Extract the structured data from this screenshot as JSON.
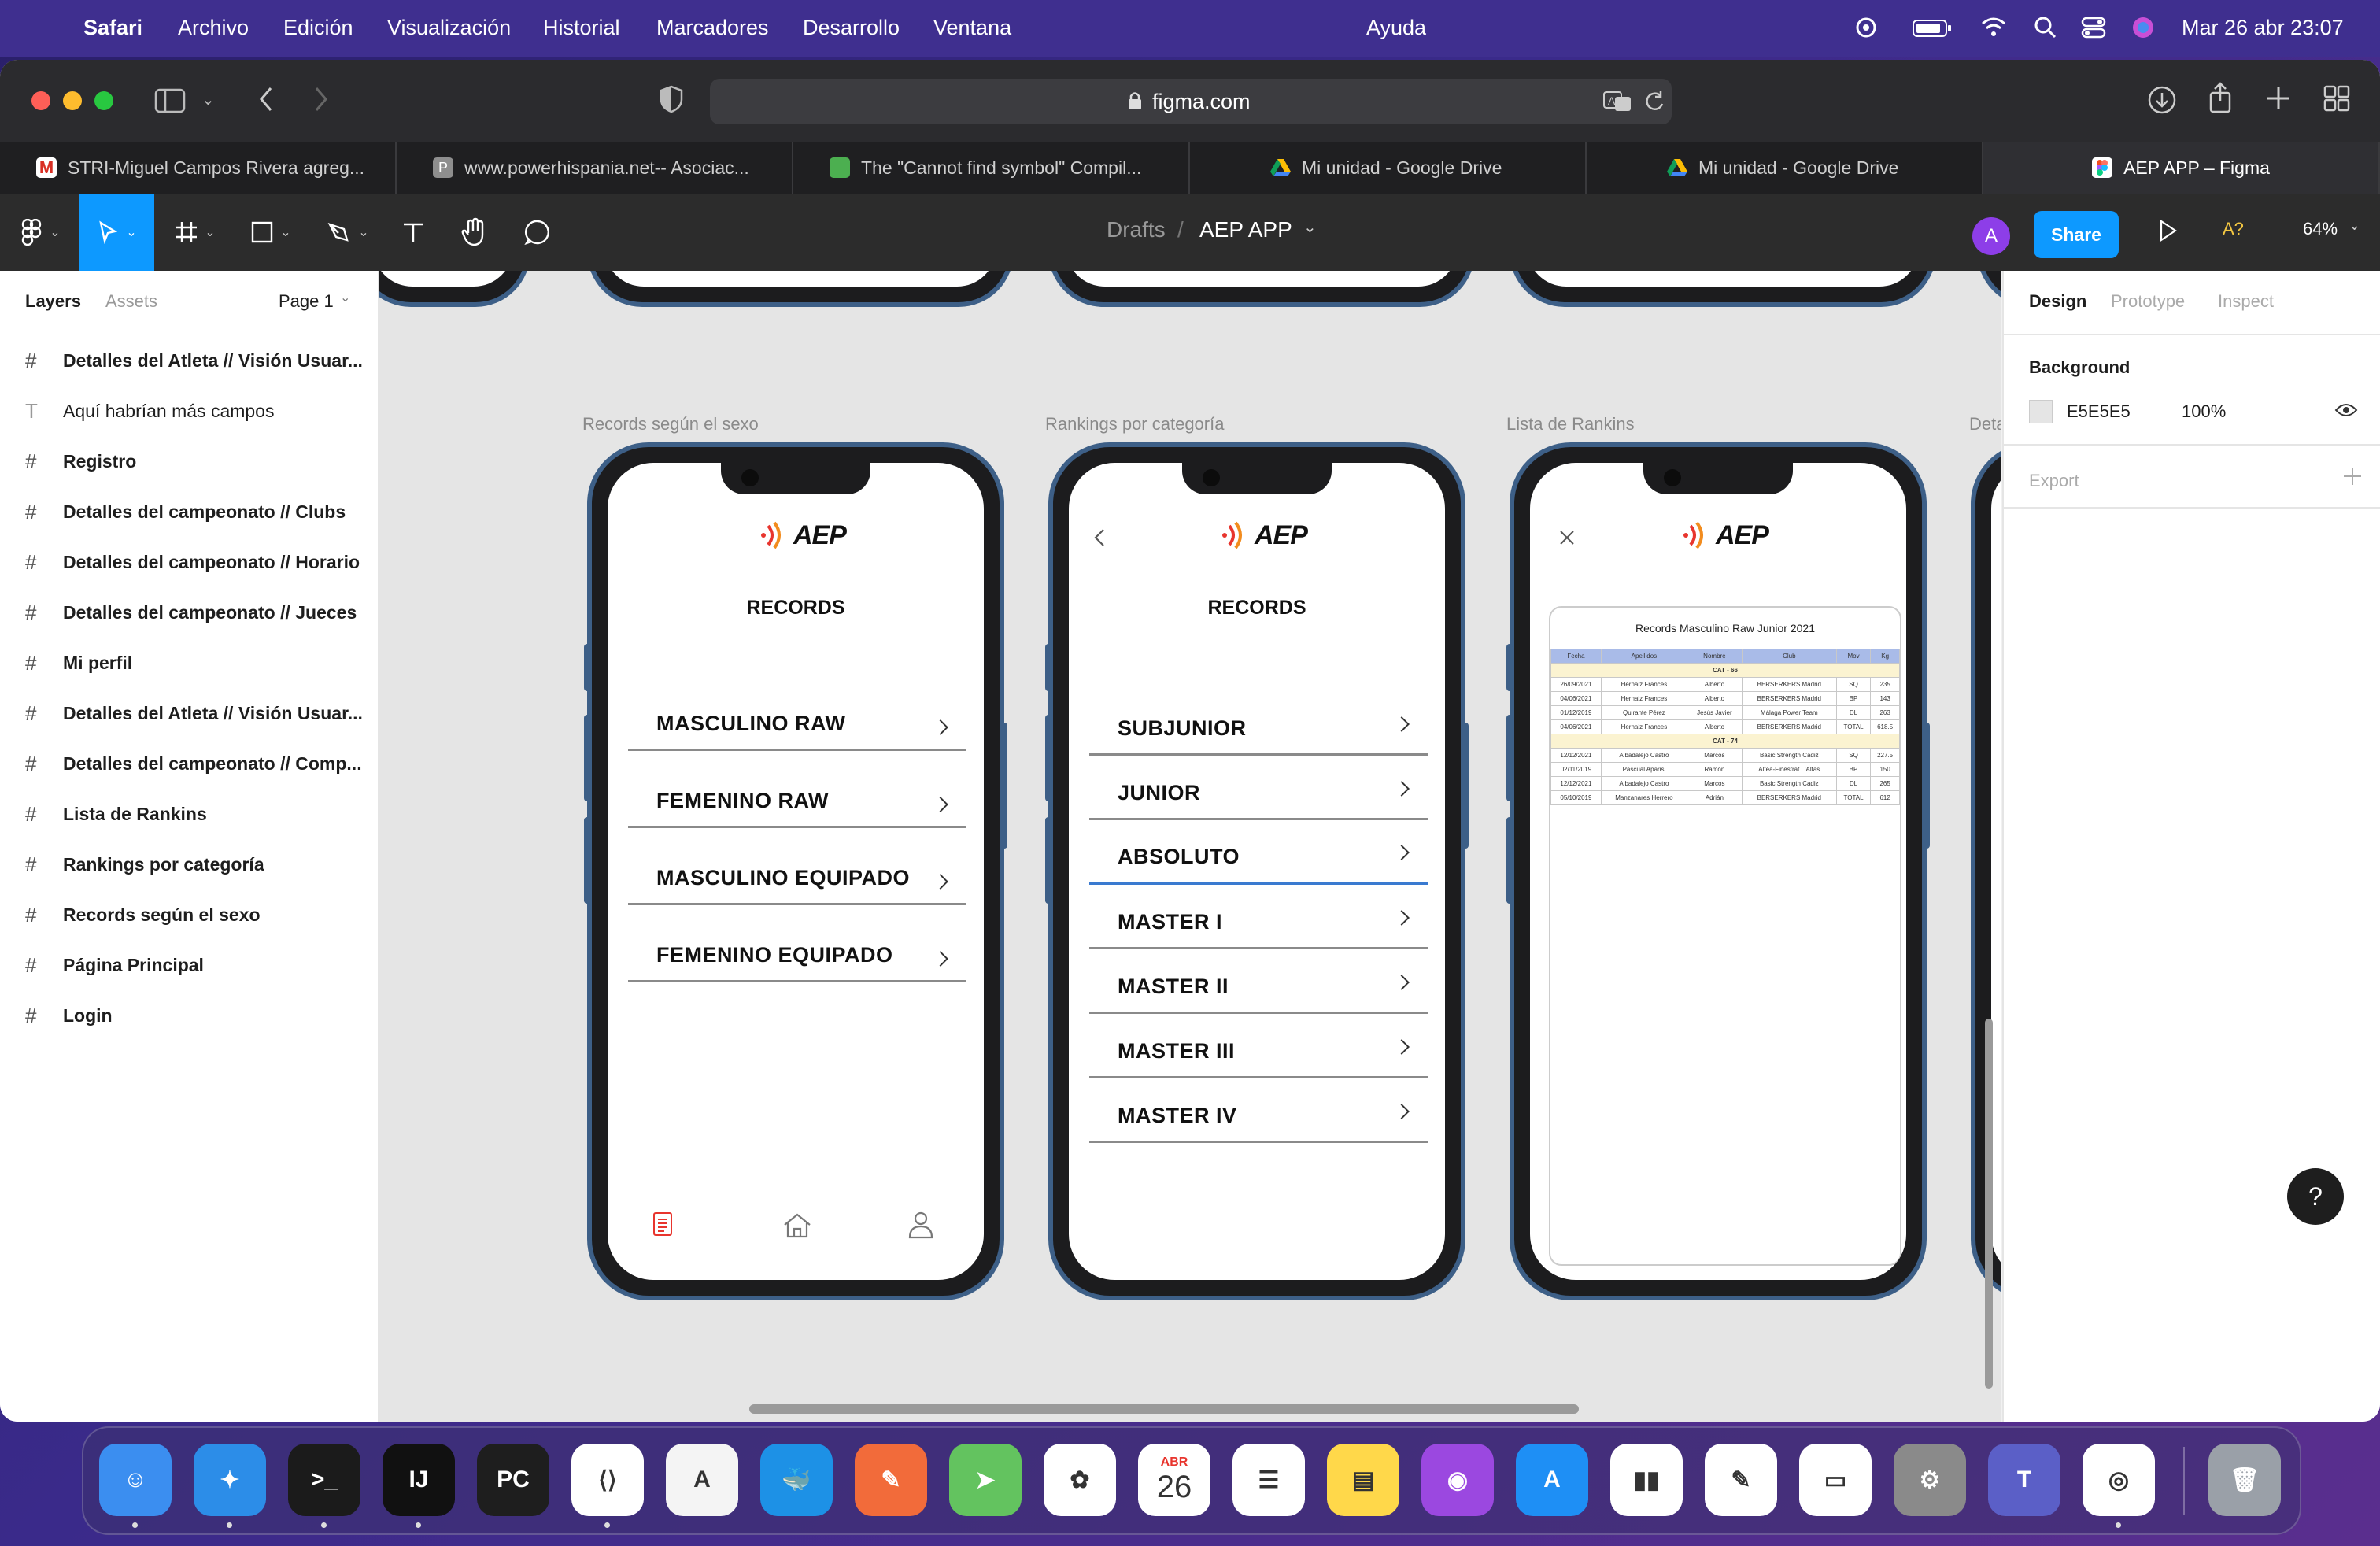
{
  "menubar": {
    "app": "Safari",
    "items": [
      "Archivo",
      "Edición",
      "Visualización",
      "Historial",
      "Marcadores",
      "Desarrollo",
      "Ventana"
    ],
    "center_item": "Ayuda",
    "datetime": "Mar 26 abr  23:07"
  },
  "browser": {
    "url": "figma.com",
    "tabs": [
      {
        "title": "STRI-Miguel Campos Rivera agreg...",
        "favicon_color": "#d93025"
      },
      {
        "title": "www.powerhispania.net-- Asociac...",
        "favicon_color": "#8e8e8e"
      },
      {
        "title": "The \"Cannot find symbol\" Compil...",
        "favicon_color": "#4caf50"
      },
      {
        "title": "Mi unidad - Google Drive",
        "favicon_color": "#fbbc04"
      },
      {
        "title": "Mi unidad - Google Drive",
        "favicon_color": "#fbbc04"
      },
      {
        "title": "AEP APP – Figma",
        "favicon_color": "#ffffff"
      }
    ]
  },
  "figma": {
    "breadcrumb_root": "Drafts",
    "breadcrumb_sep": "/",
    "file_name": "AEP APP",
    "avatar_letter": "A",
    "share_label": "Share",
    "a_label": "A?",
    "zoom": "64%"
  },
  "left_panel": {
    "tab_layers": "Layers",
    "tab_assets": "Assets",
    "page": "Page 1",
    "layers": [
      {
        "name": "Detalles del Atleta // Visión Usuar...",
        "type": "frame"
      },
      {
        "name": "Aquí habrían más campos",
        "type": "text"
      },
      {
        "name": "Registro",
        "type": "frame"
      },
      {
        "name": "Detalles del campeonato // Clubs",
        "type": "frame"
      },
      {
        "name": "Detalles del campeonato // Horario",
        "type": "frame"
      },
      {
        "name": "Detalles del campeonato // Jueces",
        "type": "frame"
      },
      {
        "name": "Mi perfil",
        "type": "frame"
      },
      {
        "name": "Detalles del Atleta // Visión Usuar...",
        "type": "frame"
      },
      {
        "name": "Detalles del campeonato // Comp...",
        "type": "frame"
      },
      {
        "name": "Lista de Rankins",
        "type": "frame"
      },
      {
        "name": "Rankings por categoría",
        "type": "frame"
      },
      {
        "name": "Records según el sexo",
        "type": "frame"
      },
      {
        "name": "Página Principal",
        "type": "frame"
      },
      {
        "name": "Login",
        "type": "frame"
      }
    ]
  },
  "canvas": {
    "frames": [
      {
        "label": "Records según el sexo"
      },
      {
        "label": "Rankings por categoría"
      },
      {
        "label": "Lista de Rankins"
      },
      {
        "label": "Deta"
      }
    ],
    "logo_text": "AEP",
    "screen1": {
      "title": "RECORDS",
      "rows": [
        "MASCULINO RAW",
        "FEMENINO RAW",
        "MASCULINO EQUIPADO",
        "FEMENINO EQUIPADO"
      ]
    },
    "screen2": {
      "title": "RECORDS",
      "rows": [
        "SUBJUNIOR",
        "JUNIOR",
        "ABSOLUTO",
        "MASTER I",
        "MASTER II",
        "MASTER III",
        "MASTER IV"
      ],
      "selected": "ABSOLUTO"
    },
    "screen3": {
      "table_title": "Records Masculino Raw Junior 2021",
      "headers": [
        "Fecha",
        "Apellidos",
        "Nombre",
        "Club",
        "Mov",
        "Kg"
      ],
      "groups": [
        {
          "cat": "CAT - 66",
          "rows": [
            [
              "26/09/2021",
              "Hernaiz Frances",
              "Alberto",
              "BERSERKERS Madrid",
              "SQ",
              "235"
            ],
            [
              "04/06/2021",
              "Hernaiz Frances",
              "Alberto",
              "BERSERKERS Madrid",
              "BP",
              "143"
            ],
            [
              "01/12/2019",
              "Quirante Pérez",
              "Jesús Javier",
              "Málaga Power Team",
              "DL",
              "263"
            ],
            [
              "04/06/2021",
              "Hernaiz Frances",
              "Alberto",
              "BERSERKERS Madrid",
              "TOTAL",
              "618.5"
            ]
          ]
        },
        {
          "cat": "CAT - 74",
          "rows": [
            [
              "12/12/2021",
              "Albadalejo Castro",
              "Marcos",
              "Basic Strength Cadiz",
              "SQ",
              "227.5"
            ],
            [
              "02/11/2019",
              "Pascual Aparisi",
              "Ramón",
              "Altea-Finestrat L'Alfas",
              "BP",
              "150"
            ],
            [
              "12/12/2021",
              "Albadalejo Castro",
              "Marcos",
              "Basic Strength Cadiz",
              "DL",
              "265"
            ],
            [
              "05/10/2019",
              "Manzanares Herrero",
              "Adrián",
              "BERSERKERS Madrid",
              "TOTAL",
              "612"
            ]
          ]
        }
      ]
    }
  },
  "right_panel": {
    "tabs": [
      "Design",
      "Prototype",
      "Inspect"
    ],
    "background_label": "Background",
    "bg_hex": "E5E5E5",
    "bg_opacity": "100%",
    "export_label": "Export",
    "help": "?"
  },
  "colors": {
    "figma_blue": "#0d99ff",
    "selection_blue": "#1668e3",
    "avatar_purple": "#8d3ee8",
    "phone_frame": "#3d5f87",
    "canvas_bg": "#e5e5e5"
  },
  "dock": {
    "apps": [
      {
        "name": "Finder",
        "color": "#3b8ef0",
        "glyph": "☺"
      },
      {
        "name": "Safari",
        "color": "#2c8de8",
        "glyph": "✦"
      },
      {
        "name": "Terminal",
        "color": "#1b1b1b",
        "glyph": ">_"
      },
      {
        "name": "IntelliJ IDEA",
        "color": "#111111",
        "glyph": "IJ"
      },
      {
        "name": "PyCharm",
        "color": "#1e1e1e",
        "glyph": "PC"
      },
      {
        "name": "Visual Studio Code",
        "color": "#ffffff",
        "glyph": "⟨⟩"
      },
      {
        "name": "Xcode Instruments",
        "color": "#f4f4f4",
        "glyph": "A"
      },
      {
        "name": "Docker",
        "color": "#1d91e6",
        "glyph": "🐳"
      },
      {
        "name": "Postman",
        "color": "#f26b3a",
        "glyph": "✎"
      },
      {
        "name": "Maps",
        "color": "#63c35f",
        "glyph": "➤"
      },
      {
        "name": "Photos",
        "color": "#ffffff",
        "glyph": "✿"
      },
      {
        "name": "Calendar",
        "color": "#ffffff",
        "glyph": "26",
        "month": "ABR"
      },
      {
        "name": "Reminders",
        "color": "#ffffff",
        "glyph": "☰"
      },
      {
        "name": "Notes",
        "color": "#ffd84a",
        "glyph": "▤"
      },
      {
        "name": "Podcasts",
        "color": "#9b48e0",
        "glyph": "◉"
      },
      {
        "name": "App Store",
        "color": "#1e8ff5",
        "glyph": "A"
      },
      {
        "name": "Numbers",
        "color": "#ffffff",
        "glyph": "▮▮"
      },
      {
        "name": "Pages",
        "color": "#ffffff",
        "glyph": "✎"
      },
      {
        "name": "Keynote",
        "color": "#ffffff",
        "glyph": "▭"
      },
      {
        "name": "System Preferences",
        "color": "#8a8a8a",
        "glyph": "⚙"
      },
      {
        "name": "Teams",
        "color": "#5b5fc7",
        "glyph": "T"
      },
      {
        "name": "Chrome",
        "color": "#ffffff",
        "glyph": "◎"
      },
      {
        "name": "Trash",
        "color": "#9aa0a8",
        "glyph": "🗑"
      }
    ]
  }
}
